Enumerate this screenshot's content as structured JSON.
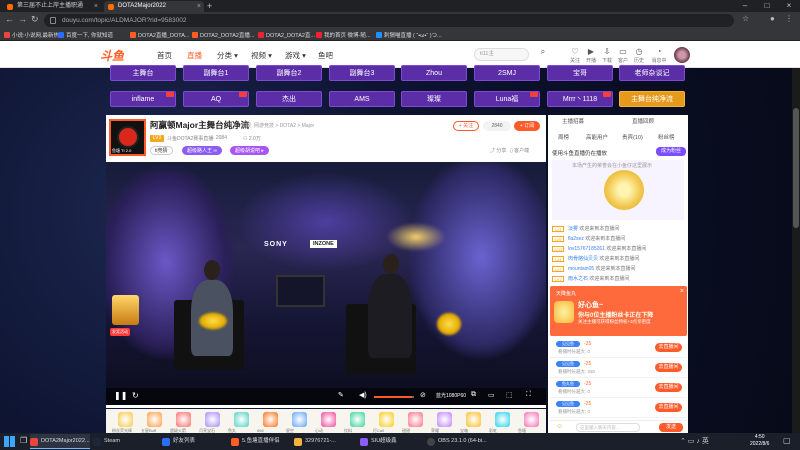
{
  "browser": {
    "tabs": [
      {
        "title": "第三届不止上岸主播职通"
      },
      {
        "title": "DOTA2Major2022"
      }
    ],
    "url": "douyu.com/topic/ALDMAJOR?rid=9583002",
    "bookmarks": [
      "小说:小说网,最新热...",
      "百度一下, 你就知道",
      "DOTA2直播_DOTA...",
      "DOTA2_DOTA2直播...",
      "DOTA2_DOTA2直...",
      "我的首页 微博-随...",
      "刺猬喵直播 ( ˘•ω•˘ )つ..."
    ]
  },
  "header": {
    "logo": "斗鱼",
    "nav": [
      "首页",
      "直播",
      "分类",
      "视频",
      "游戏",
      "鱼吧"
    ],
    "search_placeholder": "ti11主",
    "icons": [
      {
        "label": "关注",
        "icon": "heart-icon"
      },
      {
        "label": "开播",
        "icon": "play-icon"
      },
      {
        "label": "下载",
        "icon": "download-icon"
      },
      {
        "label": "客户端",
        "icon": "monitor-icon"
      },
      {
        "label": "历史",
        "icon": "history-icon"
      },
      {
        "label": "消息中心",
        "icon": "bell-icon"
      }
    ]
  },
  "streams": [
    {
      "label": "主舞台"
    },
    {
      "label": "副舞台1"
    },
    {
      "label": "副舞台2"
    },
    {
      "label": "副舞台3"
    },
    {
      "label": "Zhou"
    },
    {
      "label": "2SMJ"
    },
    {
      "label": "宝哥"
    },
    {
      "label": "老师杂谈记"
    },
    {
      "label": "inflame"
    },
    {
      "label": "AQ"
    },
    {
      "label": "杰出"
    },
    {
      "label": "AMS"
    },
    {
      "label": "璨璨"
    },
    {
      "label": "Luna福"
    },
    {
      "label": "Mrrr丶1118"
    },
    {
      "label": "主舞台纯净流"
    }
  ],
  "room": {
    "title": "阿赢顿Major主舞台纯净流",
    "report": "举报",
    "crumbs": "网游竞技 > DOTA2 > Major",
    "level": "LV3",
    "anchor": "斗鱼DOTA2赛事直播",
    "hot": "2084",
    "watch": "2.0万",
    "tags": [
      "ti竞猜",
      "超级路人王 ∞",
      "超级胡说吧 ▸"
    ],
    "follow": "+ 关注",
    "fans": "2840",
    "subscribe": "+ 订阅",
    "share": "分享",
    "client": "客户端",
    "avatar_text": "鱼塘 TI 2.0",
    "stage_brand": "SONY",
    "stage_brand2": "INZONE",
    "badge_label": "发奖活动",
    "quality": "蓝光1080P60",
    "volume": 0.95
  },
  "gifts": [
    "粉丝荧光棒",
    "五星Buff",
    "超级火箭",
    "月亮宝石",
    "鱼丸",
    "666",
    "星空",
    "心动",
    "饮料",
    "打Call",
    "甜甜",
    "荣耀",
    "宝箱",
    "彩虹",
    "鱼塘"
  ],
  "chat": {
    "tabs": [
      "主播招募",
      "直播回顾"
    ],
    "tabs2": [
      "周榜",
      "高能用户",
      "贵宾(10)",
      "粉丝榜"
    ],
    "notice": "使用斗鱼直播仍在播放",
    "notice_btn": "成为粉丝",
    "rank_text": "本场产生的荣誉会在小鱼仔这里展示",
    "messages": [
      {
        "lv": "LV3",
        "user": "淡雾",
        "text": "欢迎来到本直播间"
      },
      {
        "lv": "LV5",
        "user": "fla2sez",
        "text": "欢迎来到本直播间"
      },
      {
        "lv": "LV12",
        "user": "lov15767185261",
        "text": "欢迎来到本直播间"
      },
      {
        "lv": "LV4",
        "user": "肉骨骼仙贝贝",
        "text": "欢迎来到本直播间"
      },
      {
        "lv": "LV7",
        "user": "mountain05",
        "text": "欢迎来到本直播间"
      },
      {
        "lv": "LV1",
        "user": "雨水之石",
        "text": "欢迎来到本直播间"
      }
    ]
  },
  "popup": {
    "title": "天降鱼丸",
    "head": "好心鱼~",
    "msg": "你与0位主播粉丝卡正在下降",
    "sub": "关注主播可获得粉丝特权+3点亲密度",
    "close": "×"
  },
  "rewards": [
    {
      "tag": "见见鱼",
      "amount": "-25",
      "desc": "看播时长越大: 0",
      "go": "去直播间"
    },
    {
      "tag": "见见鱼",
      "amount": "-25",
      "desc": "看播时长越大: 250",
      "go": "去直播间"
    },
    {
      "tag": "鱼丸鱼",
      "amount": "-25",
      "desc": "看播时长越大: 0",
      "go": "去直播间"
    },
    {
      "tag": "见见鱼",
      "amount": "-25",
      "desc": "看播时长越大: 0",
      "go": "去直播间"
    }
  ],
  "chat_input": {
    "placeholder": "这里输入聊天内容...",
    "send": "发送"
  },
  "taskbar": {
    "apps": [
      {
        "label": "DOTA2Major2022..."
      },
      {
        "label": "Steam"
      },
      {
        "label": "好友列表"
      },
      {
        "label": "5.鱼塘直播伴侣"
      },
      {
        "label": "32976721-..."
      },
      {
        "label": "SIU超级鑫"
      },
      {
        "label": "OBS 23.1.0 (64-bi..."
      }
    ],
    "time": "4:50",
    "date": "2022/8/6"
  }
}
